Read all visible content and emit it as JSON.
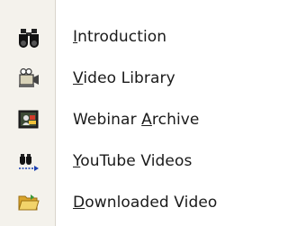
{
  "menu": {
    "items": [
      {
        "id": "introduction",
        "icon": "binoculars-icon",
        "pre": "",
        "access": "I",
        "post": "ntroduction"
      },
      {
        "id": "video-library",
        "icon": "camcorder-icon",
        "pre": "",
        "access": "V",
        "post": "ideo Library"
      },
      {
        "id": "webinar-archive",
        "icon": "webinar-icon",
        "pre": "Webinar ",
        "access": "A",
        "post": "rchive"
      },
      {
        "id": "youtube-videos",
        "icon": "binoculars-arrow-icon",
        "pre": "",
        "access": "Y",
        "post": "ouTube Videos"
      },
      {
        "id": "downloaded-video",
        "icon": "folder-open-icon",
        "pre": "",
        "access": "D",
        "post": "ownloaded Video"
      }
    ]
  },
  "colors": {
    "gutter": "#f4f2ec",
    "gutter_border": "#d9d5cc",
    "text": "#1a1a1a",
    "folder": "#e8c04a",
    "arrow": "#1a3fb0"
  }
}
